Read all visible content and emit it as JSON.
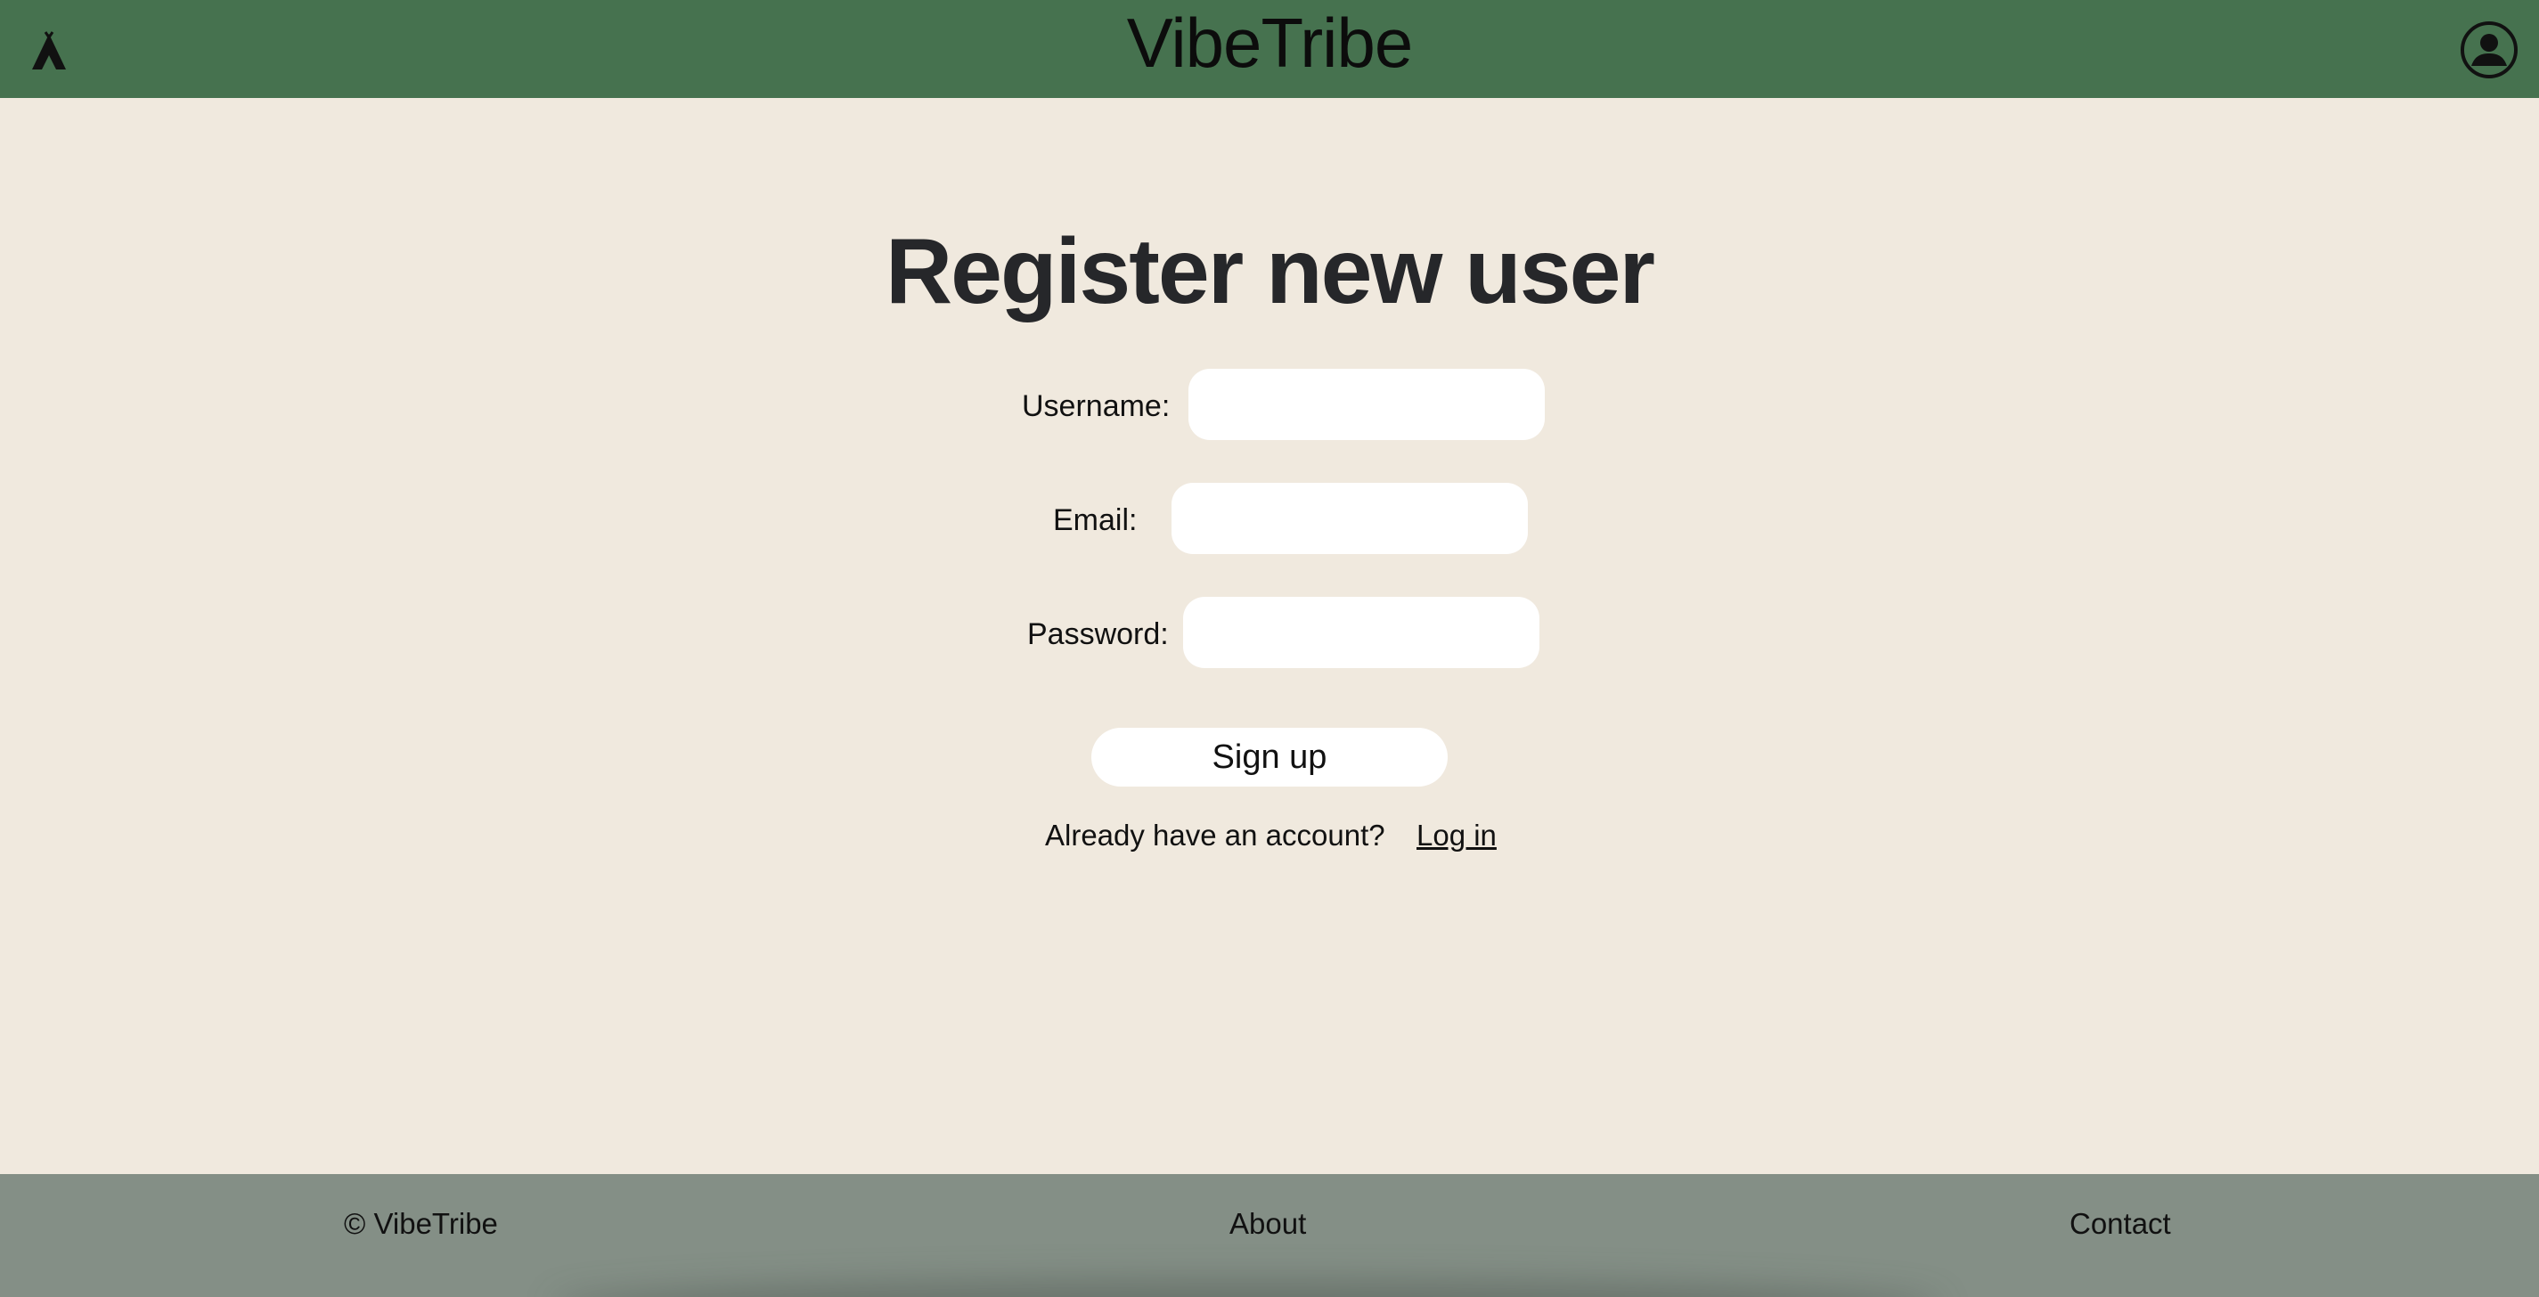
{
  "header": {
    "title": "VibeTribe",
    "logo_icon": "tent-icon",
    "profile_icon": "user-circle-icon"
  },
  "main": {
    "title": "Register new user",
    "form": {
      "username_label": "Username:",
      "username_value": "",
      "email_label": "Email:",
      "email_value": "",
      "password_label": "Password:",
      "password_value": "",
      "signup_label": "Sign up"
    },
    "already_text": "Already have an account?",
    "login_link": "Log in"
  },
  "footer": {
    "copyright": "© VibeTribe",
    "about": "About",
    "contact": "Contact"
  },
  "colors": {
    "header_bg": "#46724f",
    "page_bg": "#f0e9de",
    "footer_bg": "#848f86",
    "input_bg": "#ffffff"
  }
}
